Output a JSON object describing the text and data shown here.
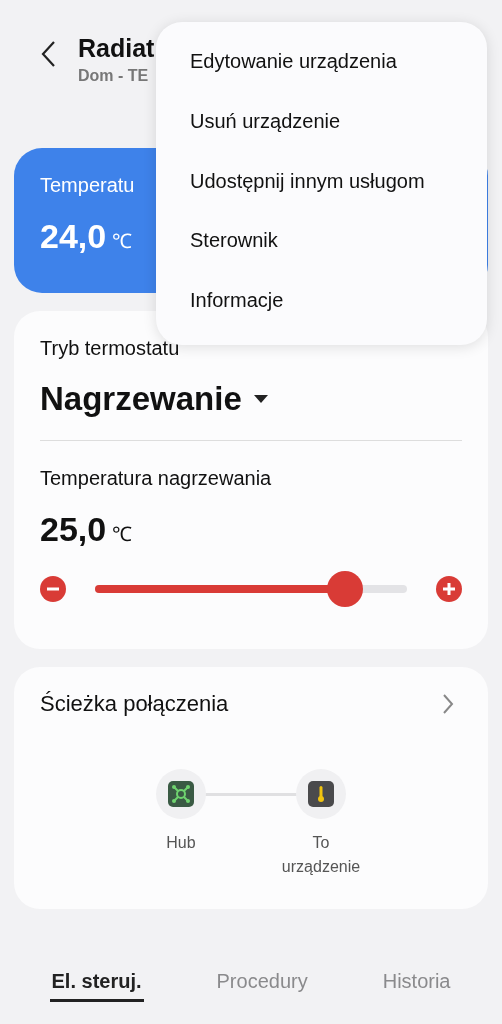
{
  "header": {
    "title": "Radiat",
    "subtitle": "Dom - TE"
  },
  "current_card": {
    "label": "Temperatu",
    "value": "24,0",
    "unit": "℃"
  },
  "menu": {
    "items": [
      {
        "label": "Edytowanie urządzenia"
      },
      {
        "label": "Usuń urządzenie"
      },
      {
        "label": "Udostępnij innym usługom"
      },
      {
        "label": "Sterownik"
      },
      {
        "label": "Informacje"
      }
    ]
  },
  "thermostat_card": {
    "mode_label": "Tryb termostatu",
    "mode_value": "Nagrzewanie",
    "setpoint_label": "Temperatura nagrzewania",
    "setpoint_value": "25,0",
    "setpoint_unit": "℃",
    "slider": {
      "level": 0.8
    }
  },
  "connection_card": {
    "title": "Ścieżka połączenia",
    "nodes": [
      {
        "kind": "hub",
        "label": "Hub"
      },
      {
        "kind": "device",
        "label": "To urządzenie"
      }
    ]
  },
  "tabs": [
    {
      "label": "El. steruj.",
      "selected": true
    },
    {
      "label": "Procedury",
      "selected": false
    },
    {
      "label": "Historia",
      "selected": false
    }
  ]
}
